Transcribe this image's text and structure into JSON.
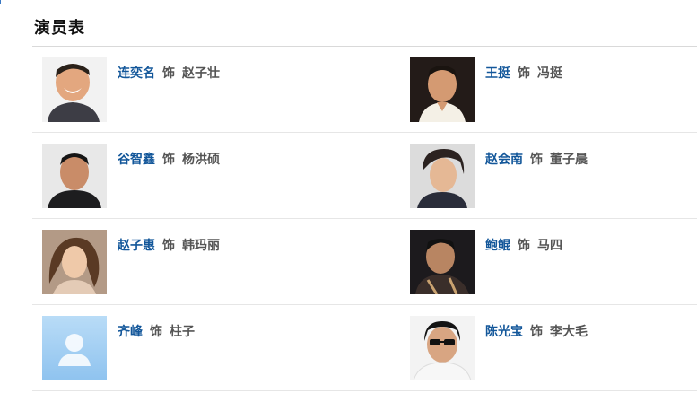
{
  "section": {
    "title": "演员表"
  },
  "cast": [
    {
      "actor": "连奕名",
      "as": "饰",
      "role": "赵子壮",
      "photo": "portrait-photo"
    },
    {
      "actor": "王挺",
      "as": "饰",
      "role": "冯挺",
      "photo": "portrait-photo"
    },
    {
      "actor": "谷智鑫",
      "as": "饰",
      "role": "杨洪硕",
      "photo": "portrait-photo"
    },
    {
      "actor": "赵会南",
      "as": "饰",
      "role": "董子晨",
      "photo": "portrait-photo"
    },
    {
      "actor": "赵子惠",
      "as": "饰",
      "role": "韩玛丽",
      "photo": "portrait-photo"
    },
    {
      "actor": "鲍鲲",
      "as": "饰",
      "role": "马四",
      "photo": "portrait-photo"
    },
    {
      "actor": "齐峰",
      "as": "饰",
      "role": "柱子",
      "photo": "default-avatar-icon"
    },
    {
      "actor": "陈光宝",
      "as": "饰",
      "role": "李大毛",
      "photo": "portrait-photo"
    }
  ],
  "colors": {
    "actor_link": "#13579a",
    "role_text": "#555555",
    "divider": "#e6e6e6",
    "placeholder_avatar_bg": "#a9d1f3"
  }
}
